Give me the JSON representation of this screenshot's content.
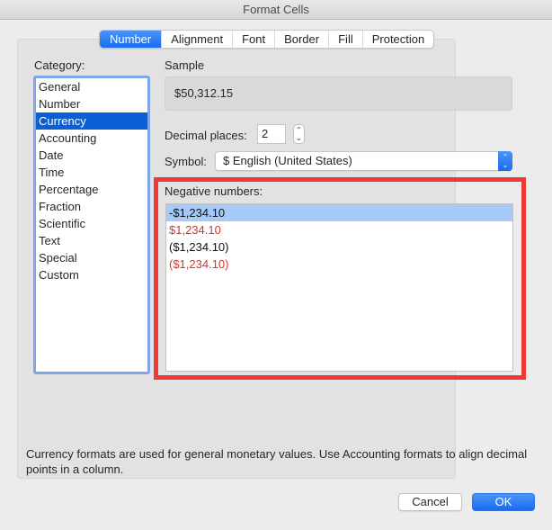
{
  "window": {
    "title": "Format Cells"
  },
  "tabs": [
    {
      "label": "Number",
      "active": true
    },
    {
      "label": "Alignment",
      "active": false
    },
    {
      "label": "Font",
      "active": false
    },
    {
      "label": "Border",
      "active": false
    },
    {
      "label": "Fill",
      "active": false
    },
    {
      "label": "Protection",
      "active": false
    }
  ],
  "category": {
    "label": "Category:",
    "selected": "Currency",
    "items": [
      "General",
      "Number",
      "Currency",
      "Accounting",
      "Date",
      "Time",
      "Percentage",
      "Fraction",
      "Scientific",
      "Text",
      "Special",
      "Custom"
    ]
  },
  "sample": {
    "label": "Sample",
    "value": "$50,312.15"
  },
  "decimal_places": {
    "label": "Decimal places:",
    "value": "2",
    "stepper_icon": "up-down-stepper-icon"
  },
  "symbol": {
    "label": "Symbol:",
    "value": "$ English (United States)",
    "arrow_icon": "up-down-chevron-icon"
  },
  "negative_numbers": {
    "label": "Negative numbers:",
    "items": [
      {
        "text": "-$1,234.10",
        "color": "#111111",
        "selected": true
      },
      {
        "text": "$1,234.10",
        "color": "#e2302b",
        "selected": false
      },
      {
        "text": "($1,234.10)",
        "color": "#111111",
        "selected": false
      },
      {
        "text": "($1,234.10)",
        "color": "#e2302b",
        "selected": false
      }
    ]
  },
  "highlight_color": "#ee3a34",
  "accent_color": "#1a6df0",
  "description": "Currency formats are used for general monetary values.  Use Accounting formats to align decimal points in a column.",
  "buttons": {
    "cancel": "Cancel",
    "ok": "OK"
  }
}
